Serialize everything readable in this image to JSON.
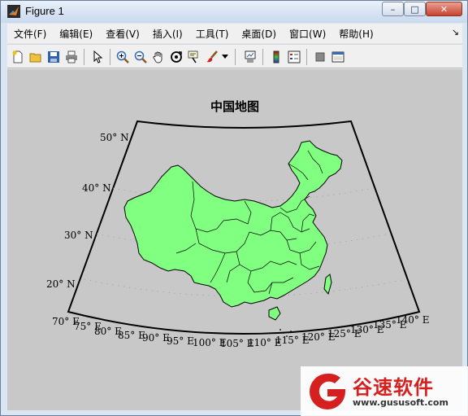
{
  "window": {
    "title": "Figure 1",
    "controls": {
      "minimize": "–",
      "maximize": "□",
      "close": "✕"
    }
  },
  "menubar": {
    "items": [
      {
        "label": "文件(F)"
      },
      {
        "label": "编辑(E)"
      },
      {
        "label": "查看(V)"
      },
      {
        "label": "插入(I)"
      },
      {
        "label": "工具(T)"
      },
      {
        "label": "桌面(D)"
      },
      {
        "label": "窗口(W)"
      },
      {
        "label": "帮助(H)"
      }
    ],
    "dock_glyph": "↘"
  },
  "toolbar": {
    "icons": [
      "new-figure-icon",
      "open-file-icon",
      "save-icon",
      "print-icon",
      "select-arrow-icon",
      "zoom-in-icon",
      "zoom-out-icon",
      "pan-hand-icon",
      "rotate-3d-icon",
      "data-cursor-icon",
      "brush-icon",
      "dropdown-arrow-icon",
      "link-plot-icon",
      "colorbar-icon",
      "legend-icon",
      "hide-plot-tools-icon",
      "show-plot-tools-icon"
    ]
  },
  "figure": {
    "title": "中国地图",
    "background": "#c8c8c8",
    "land_color": "#80ff80",
    "latitude_labels": [
      "20° N",
      "30° N",
      "40° N",
      "50° N"
    ],
    "longitude_labels": [
      "70° E",
      "75° E",
      "80° E",
      "85° E",
      "90° E",
      "95° E",
      "100° E",
      "105° E",
      "110° E",
      "115° E",
      "120° E",
      "125° E",
      "130° E",
      "135° E",
      "140° E"
    ]
  },
  "watermark": {
    "brand_cn": "谷速软件",
    "url": "www.gususoft.com",
    "brand_color": "#d62020"
  }
}
